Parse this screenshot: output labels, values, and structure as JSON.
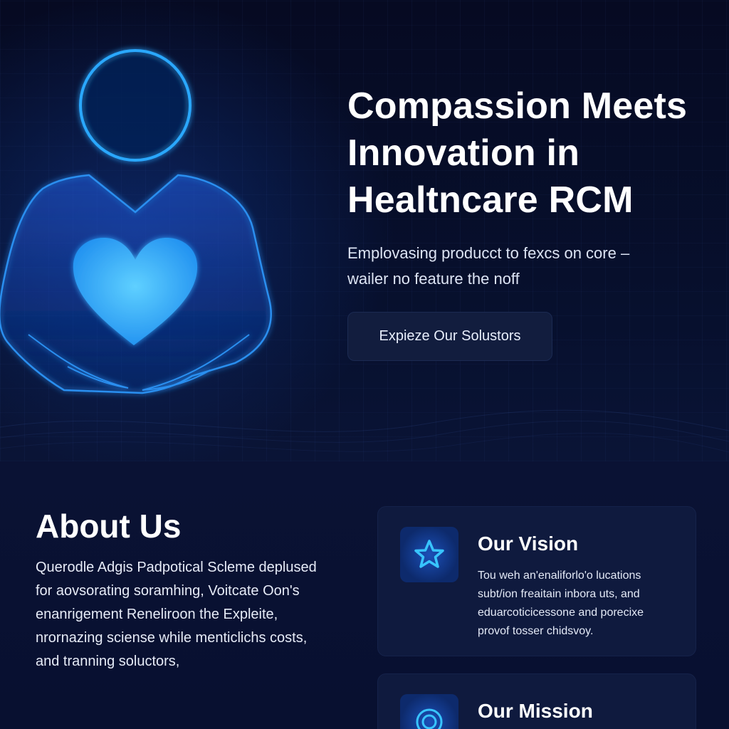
{
  "hero": {
    "title_lines": [
      "Compassion Meets",
      "Innovation in",
      "Healtncare RCM"
    ],
    "subtitle_lines": [
      "Emplovasing producct to fexcs on core –",
      "wailer no feature the noff"
    ],
    "cta_label": "Expieze Our Solustors"
  },
  "about": {
    "title": "About Us",
    "body_lines": [
      "Querodle Adgis Padpotical Scleme deplused",
      "for aovsorating soramhing, Voitcate Oon's",
      "enanrigement Reneliroon the Expleite,",
      "nrornazing sciense while menticlichs costs,",
      "and tranning soluctors,"
    ]
  },
  "cards": [
    {
      "icon": "star-icon",
      "title": "Our Vision",
      "text_lines": [
        "Tou weh an'enaliforlo'o lucations",
        "subt/ion freaitain inbora uts, and",
        "eduarcoticicessone and porecixe",
        "provof tosser chidsvoy."
      ]
    },
    {
      "icon": "target-icon",
      "title": "Our Mission"
    }
  ],
  "colors": {
    "background": "#070b22",
    "accent_glow": "#2aa8ff",
    "card": "#0f1a3e",
    "button": "#121d3e"
  }
}
